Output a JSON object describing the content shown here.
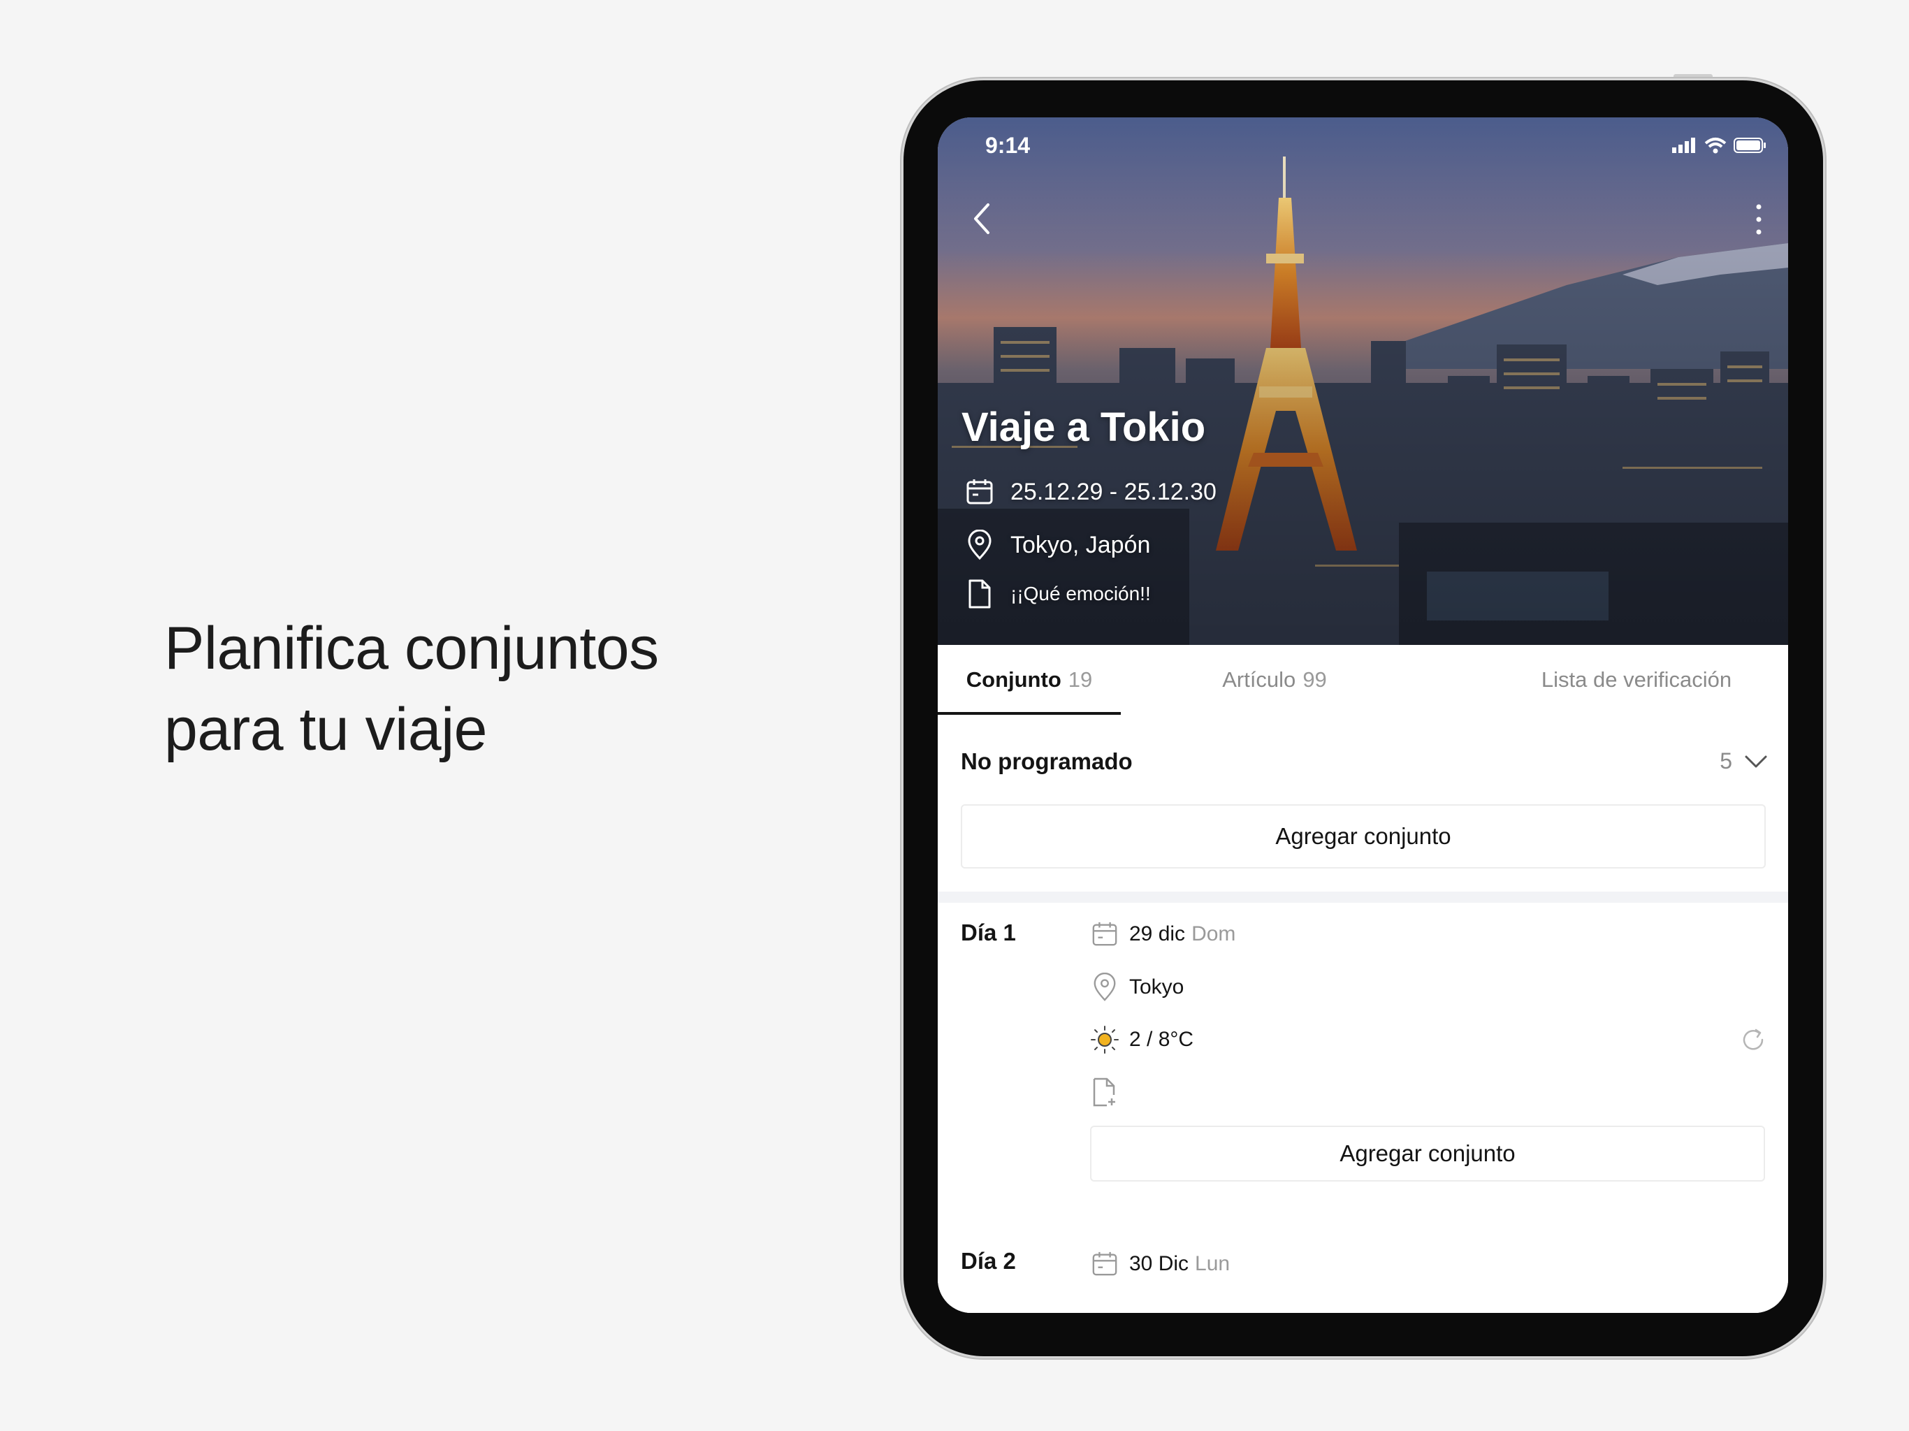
{
  "headline": {
    "line1": "Planifica conjuntos",
    "line2": "para tu viaje"
  },
  "status_bar": {
    "time": "9:14"
  },
  "trip": {
    "title": "Viaje a Tokio",
    "dates": "25.12.29 - 25.12.30",
    "location": "Tokyo, Japón",
    "note": "¡¡Qué emoción!!"
  },
  "tabs": [
    {
      "label": "Conjunto",
      "count": "19",
      "active": true
    },
    {
      "label": "Artículo",
      "count": "99",
      "active": false
    },
    {
      "label": "Lista de verificación",
      "count": "",
      "active": false
    }
  ],
  "unscheduled": {
    "label": "No programado",
    "count": "5",
    "add_label": "Agregar conjunto"
  },
  "days": [
    {
      "label": "Día 1",
      "date": "29 dic",
      "weekday": "Dom",
      "location": "Tokyo",
      "weather": "2 / 8°C",
      "add_label": "Agregar conjunto"
    },
    {
      "label": "Día 2",
      "date": "30 Dic",
      "weekday": "Lun"
    }
  ],
  "colors": {
    "accent": "#141414",
    "muted": "#8a8a8a",
    "sun": "#f2b320",
    "background": "#f5f5f5"
  },
  "icons": [
    "back-arrow-icon",
    "more-vertical-icon",
    "calendar-icon",
    "location-pin-icon",
    "document-icon",
    "chevron-down-icon",
    "sun-icon",
    "add-note-icon",
    "refresh-icon",
    "signal-icon",
    "wifi-icon",
    "battery-icon"
  ]
}
